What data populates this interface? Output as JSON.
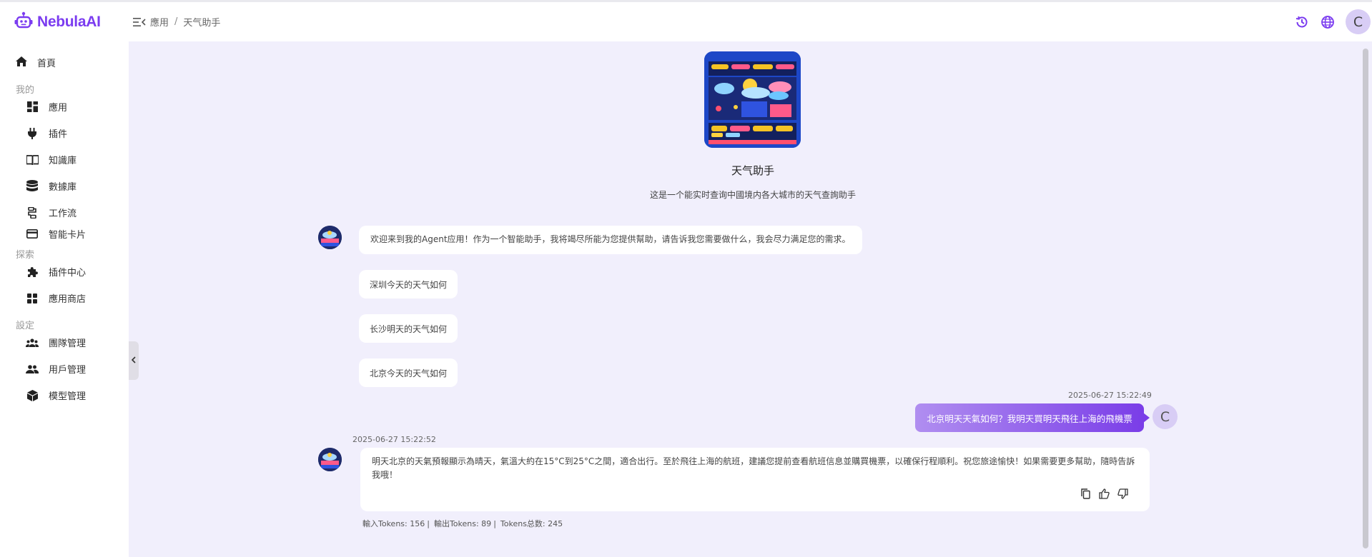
{
  "app": {
    "name": "NebulaAI"
  },
  "breadcrumb": {
    "root": "應用",
    "sep": "/",
    "current": "天气助手"
  },
  "sidebar": {
    "home": "首頁",
    "group_mine": "我的",
    "mine": [
      {
        "label": "應用",
        "icon": "dashboard-icon"
      },
      {
        "label": "插件",
        "icon": "plug-icon"
      },
      {
        "label": "知識庫",
        "icon": "book-icon"
      },
      {
        "label": "數據庫",
        "icon": "database-icon"
      },
      {
        "label": "工作流",
        "icon": "workflow-icon"
      },
      {
        "label": "智能卡片",
        "icon": "card-icon"
      }
    ],
    "group_explore": "探索",
    "explore": [
      {
        "label": "插件中心",
        "icon": "puzzle-icon"
      },
      {
        "label": "應用商店",
        "icon": "grid-icon"
      }
    ],
    "group_settings": "設定",
    "settings": [
      {
        "label": "團隊管理",
        "icon": "team-icon"
      },
      {
        "label": "用戶管理",
        "icon": "users-icon"
      },
      {
        "label": "模型管理",
        "icon": "cube-icon"
      }
    ]
  },
  "header": {
    "user_initial": "C"
  },
  "agent": {
    "name": "天气助手",
    "description": "这是一个能实时查询中國境内各大城市的天气查詢助手"
  },
  "chat": {
    "welcome": "欢迎来到我的Agent应用！作为一个智能助手，我将竭尽所能为您提供幫助，请告诉我您需要做什么，我会尽力满足您的需求。",
    "suggestions": [
      "深圳今天的天气如何",
      "长沙明天的天气如何",
      "北京今天的天气如何"
    ],
    "user_time": "2025-06-27 15:22:49",
    "user_message": "北京明天天氣如何？我明天買明天飛往上海的飛機票",
    "user_initial": "C",
    "bot_time": "2025-06-27 15:22:52",
    "bot_message": "明天北京的天氣預報顯示為晴天，氣溫大約在15°C到25°C之間，適合出行。至於飛往上海的航班，建議您提前查看航班信息並購買機票，以確保行程順利。祝您旅途愉快！如果需要更多幫助，隨時告訴我哦！",
    "tokens": {
      "input": "輸入Tokens: 156",
      "output": "輸出Tokens: 89",
      "total": "Tokens总数: 245",
      "pipe": "|"
    }
  },
  "colors": {
    "accent": "#7b3cf0",
    "background": "#f1effc"
  }
}
